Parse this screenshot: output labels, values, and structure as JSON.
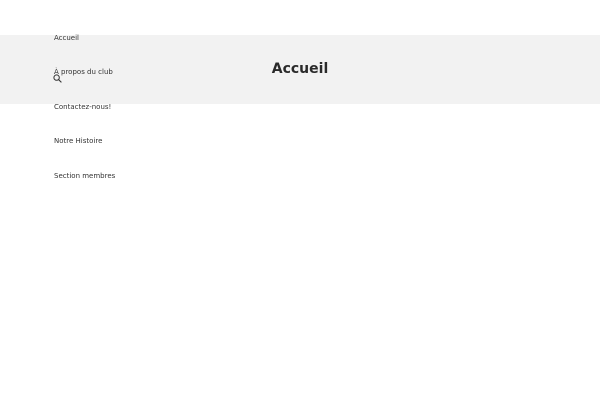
{
  "page": {
    "title": "Accueil"
  },
  "nav": {
    "items": [
      {
        "label": "Accueil"
      },
      {
        "label": "À propos du club"
      },
      {
        "label": "Contactez-nous!"
      },
      {
        "label": "Notre Histoire"
      },
      {
        "label": "Section membres"
      }
    ]
  },
  "icons": {
    "search": "search-icon"
  },
  "colors": {
    "title_band": "#f2f2f2",
    "text": "#333333",
    "background": "#ffffff"
  }
}
